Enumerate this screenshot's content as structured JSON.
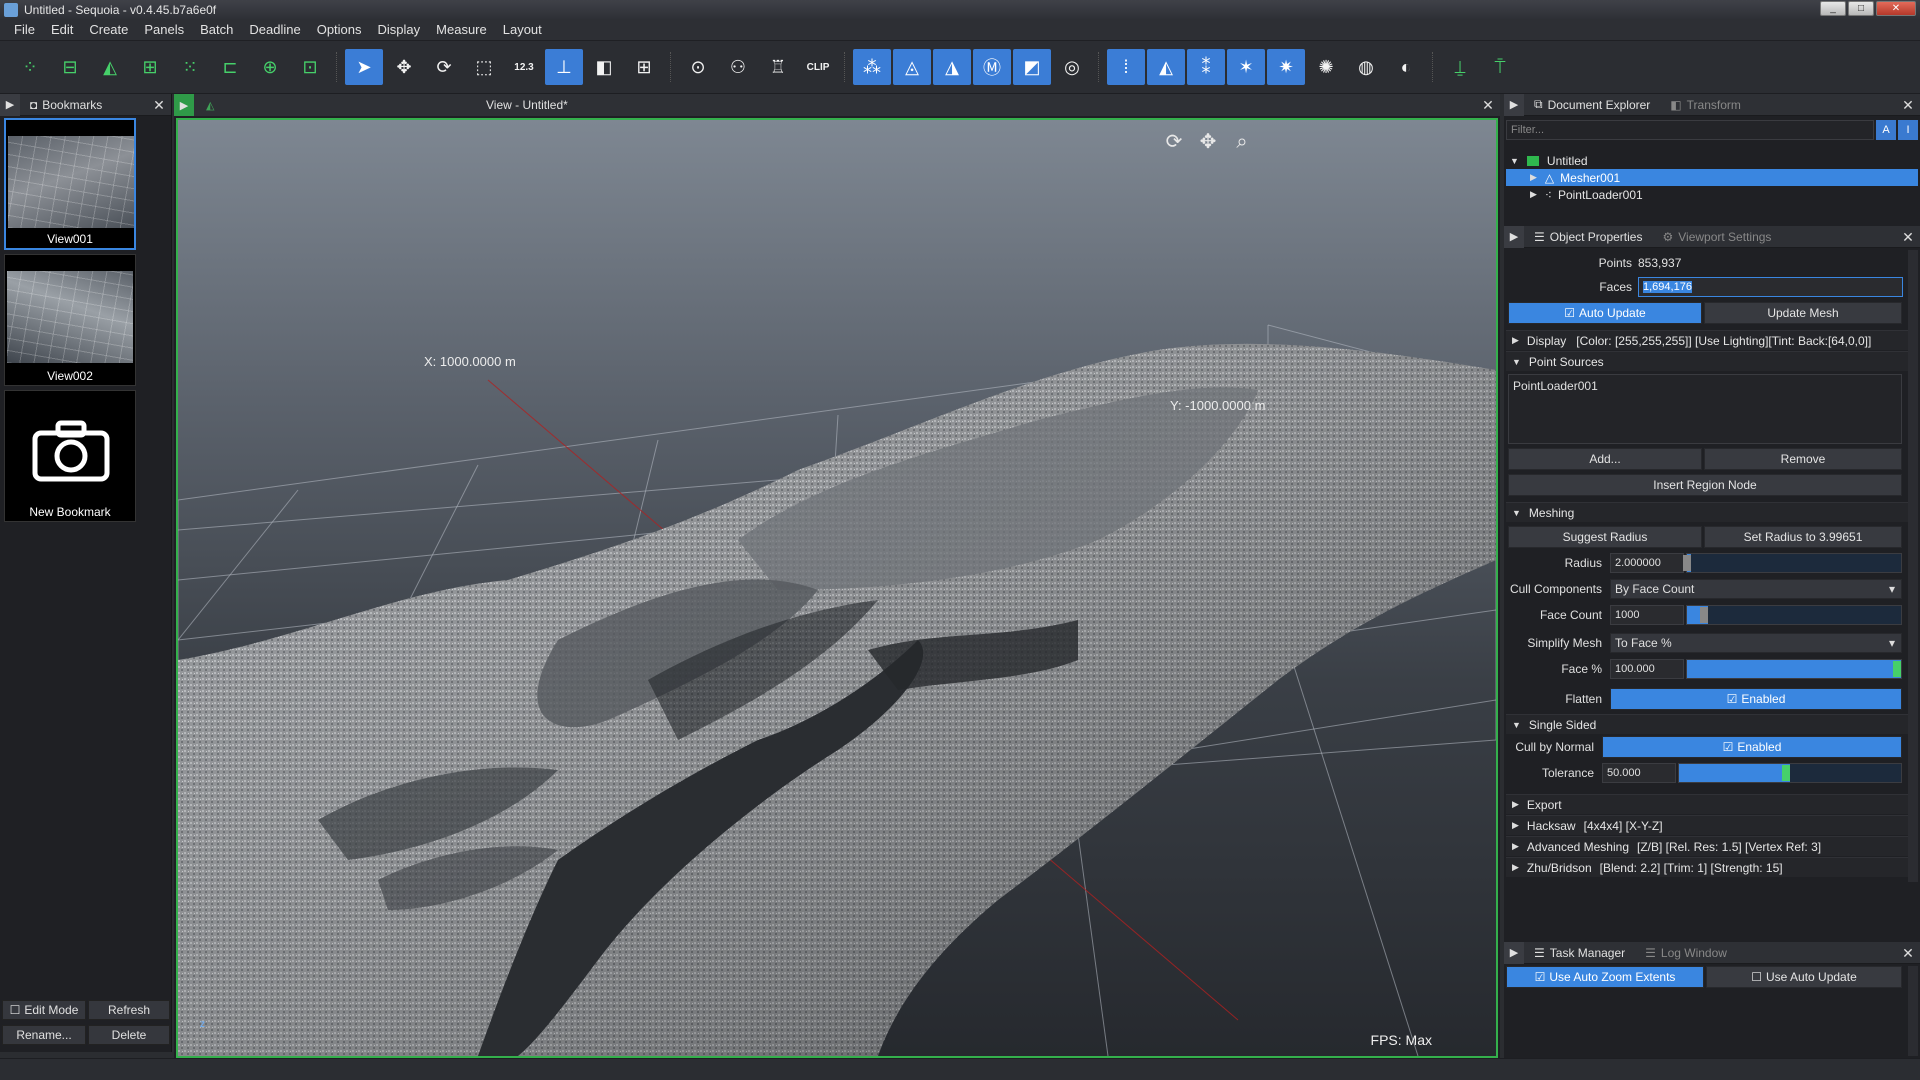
{
  "window": {
    "title": "Untitled - Sequoia - v0.4.45.b7a6e0f",
    "min": "_",
    "max": "□",
    "close": "✕"
  },
  "menu": [
    "File",
    "Edit",
    "Create",
    "Panels",
    "Batch",
    "Deadline",
    "Options",
    "Display",
    "Measure",
    "Layout"
  ],
  "toolbar": {
    "numeric_label": "12.3",
    "clip_label": "CLIP",
    "buttons": [
      {
        "icon": "point-cloud-add-icon"
      },
      {
        "icon": "point-cloud-box-icon"
      },
      {
        "icon": "point-cloud-mesh-icon"
      },
      {
        "icon": "point-cloud-sample-icon"
      },
      {
        "icon": "point-cloud-filter-icon"
      },
      {
        "icon": "point-cloud-transform-icon"
      },
      {
        "icon": "point-cloud-merge-icon"
      },
      {
        "icon": "point-cloud-region-icon"
      },
      {
        "icon": "select-pointer-icon"
      },
      {
        "icon": "move-icon"
      },
      {
        "icon": "rotate-icon"
      },
      {
        "icon": "scale-icon"
      },
      {
        "icon": "measure-icon"
      },
      {
        "icon": "axis-icon"
      },
      {
        "icon": "view-cube-icon"
      },
      {
        "icon": "grid-icon"
      },
      {
        "icon": "focus-icon"
      },
      {
        "icon": "people-icon"
      },
      {
        "icon": "tower-icon"
      },
      {
        "icon": "clip-icon"
      },
      {
        "icon": "mesher-icon"
      },
      {
        "icon": "mesh-icon"
      },
      {
        "icon": "mesh-edit-icon"
      },
      {
        "icon": "mesh-m-icon"
      },
      {
        "icon": "mesh-camera-icon"
      },
      {
        "icon": "camera-icon"
      },
      {
        "icon": "points-a-icon"
      },
      {
        "icon": "points-b-icon"
      },
      {
        "icon": "points-c-icon"
      },
      {
        "icon": "points-d-icon"
      },
      {
        "icon": "points-e-icon"
      },
      {
        "icon": "light-icon"
      },
      {
        "icon": "sphere-icon"
      },
      {
        "icon": "shade-icon"
      },
      {
        "icon": "pin-add-icon"
      },
      {
        "icon": "pin-zero-icon"
      }
    ]
  },
  "bookmarks": {
    "tab": "Bookmarks",
    "items": [
      {
        "label": "View001"
      },
      {
        "label": "View002"
      },
      {
        "label": "New Bookmark"
      }
    ],
    "edit_mode": "Edit Mode",
    "refresh": "Refresh",
    "rename": "Rename...",
    "delete": "Delete"
  },
  "view": {
    "title": "View - Untitled*",
    "axis_x": "X: 1000.0000 m",
    "axis_y": "Y: -1000.0000 m",
    "fps": "FPS: Max",
    "axis_z": "z"
  },
  "explorer": {
    "tab_active": "Document Explorer",
    "tab_inactive": "Transform",
    "filter_placeholder": "Filter...",
    "filter_btn_a": "A",
    "filter_btn_b": "I",
    "tree": [
      {
        "label": "Untitled"
      },
      {
        "label": "Mesher001"
      },
      {
        "label": "PointLoader001"
      }
    ]
  },
  "properties": {
    "tab_active": "Object Properties",
    "tab_inactive": "Viewport Settings",
    "points_label": "Points",
    "points_value": "853,937",
    "faces_label": "Faces",
    "faces_value": "1,694,176",
    "auto_update": "Auto Update",
    "update_mesh": "Update Mesh",
    "display_group": "Display",
    "display_summary": "[Color: [255,255,255]] [Use Lighting][Tint: Back:[64,0,0]]",
    "point_sources_group": "Point Sources",
    "point_source_item": "PointLoader001",
    "add": "Add...",
    "remove": "Remove",
    "insert_region": "Insert Region Node",
    "meshing_group": "Meshing",
    "suggest_radius": "Suggest Radius",
    "set_radius": "Set Radius to 3.99651",
    "radius_label": "Radius",
    "radius_value": "2.000000",
    "radius_fraction": 0.02,
    "cull_label": "Cull Components",
    "cull_value": "By Face Count",
    "face_count_label": "Face Count",
    "face_count_value": "1000",
    "face_count_fraction": 0.1,
    "simplify_label": "Simplify Mesh",
    "simplify_value": "To Face %",
    "face_pct_label": "Face %",
    "face_pct_value": "100.000",
    "face_pct_fraction": 1.0,
    "flatten_label": "Flatten",
    "flatten_value": "Enabled",
    "single_sided_group": "Single Sided",
    "cull_normal_label": "Cull by Normal",
    "cull_normal_value": "Enabled",
    "tolerance_label": "Tolerance",
    "tolerance_value": "50.000",
    "tolerance_fraction": 0.5,
    "export_group": "Export",
    "hacksaw_group": "Hacksaw",
    "hacksaw_summary": "[4x4x4] [X-Y-Z]",
    "adv_group": "Advanced Meshing",
    "adv_summary": "[Z/B] [Rel. Res: 1.5] [Vertex Ref: 3]",
    "zhu_group": "Zhu/Bridson",
    "zhu_summary": "[Blend: 2.2] [Trim: 1] [Strength: 15]"
  },
  "tasks": {
    "tab_active": "Task Manager",
    "tab_inactive": "Log Window",
    "auto_zoom": "Use Auto Zoom Extents",
    "auto_update": "Use Auto Update"
  },
  "colors": {
    "accent": "#3a86e0",
    "green": "#46d06a",
    "border_green": "#34b04c"
  }
}
